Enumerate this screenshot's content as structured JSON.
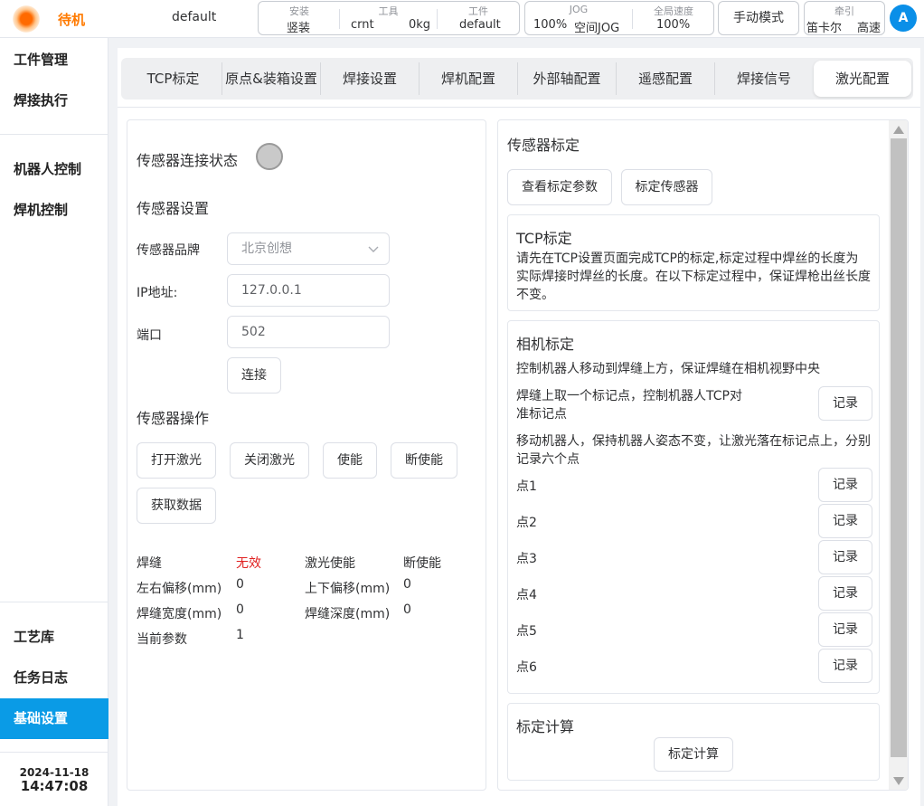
{
  "header": {
    "status": "待机",
    "program": "default",
    "install": {
      "label": "安装",
      "value": "竖装"
    },
    "tool": {
      "label": "工具",
      "name": "crnt",
      "load": "0kg"
    },
    "workpiece": {
      "label": "工件",
      "value": "default"
    },
    "jog": {
      "label": "JOG",
      "speed": "100%",
      "mode": "空间JOG"
    },
    "global_speed": {
      "label": "全局速度",
      "value": "100%"
    },
    "mode_button": "手动模式",
    "traction": {
      "label": "牵引",
      "coord": "笛卡尔",
      "speed": "高速"
    },
    "avatar": "A"
  },
  "sidebar": {
    "items": [
      "工件管理",
      "焊接执行",
      "机器人控制",
      "焊机控制",
      "工艺库",
      "任务日志",
      "基础设置"
    ],
    "date": "2024-11-18",
    "time": "14:47:08"
  },
  "tabs": [
    "TCP标定",
    "原点&装箱设置",
    "焊接设置",
    "焊机配置",
    "外部轴配置",
    "遥感配置",
    "焊接信号",
    "激光配置"
  ],
  "left": {
    "conn_status_label": "传感器连接状态",
    "settings_title": "传感器设置",
    "brand_label": "传感器品牌",
    "brand_value": "北京创想",
    "ip_label": "IP地址:",
    "ip_value": "127.0.0.1",
    "port_label": "端口",
    "port_value": "502",
    "connect_button": "连接",
    "ops_title": "传感器操作",
    "ops_buttons": [
      "打开激光",
      "关闭激光",
      "使能",
      "断使能",
      "获取数据"
    ],
    "readings": {
      "seam_label": "焊缝",
      "seam_value": "无效",
      "laser_enable_label": "激光使能",
      "laser_enable_value": "断使能",
      "lr_offset_label": "左右偏移(mm)",
      "lr_offset_value": "0",
      "ud_offset_label": "上下偏移(mm)",
      "ud_offset_value": "0",
      "width_label": "焊缝宽度(mm)",
      "width_value": "0",
      "depth_label": "焊缝深度(mm)",
      "depth_value": "0",
      "param_label": "当前参数",
      "param_value": "1"
    }
  },
  "right": {
    "title": "传感器标定",
    "view_params_button": "查看标定参数",
    "calibrate_button": "标定传感器",
    "tcp_card": {
      "title": "TCP标定",
      "lines": [
        "请先在TCP设置页面完成TCP的标定,标定过程中焊丝的长度为",
        "实际焊接时焊丝的长度。在以下标定过程中，保证焊枪出丝长度",
        "不变。"
      ]
    },
    "camera_card": {
      "title": "相机标定",
      "line1": "控制机器人移动到焊缝上方，保证焊缝在相机视野中央",
      "mark_lines": [
        "焊缝上取一个标记点，控制机器人TCP对",
        "准标记点"
      ],
      "move_lines": [
        "移动机器人，保持机器人姿态不变，让激光落在标记点上，分别",
        "记录六个点"
      ],
      "record_label": "记录",
      "points": [
        "点1",
        "点2",
        "点3",
        "点4",
        "点5",
        "点6"
      ]
    },
    "calc_card": {
      "title": "标定计算",
      "button": "标定计算"
    }
  },
  "colors": {
    "accent": "#0a9be6",
    "status": "#ff7a00",
    "invalid": "#e02020"
  }
}
